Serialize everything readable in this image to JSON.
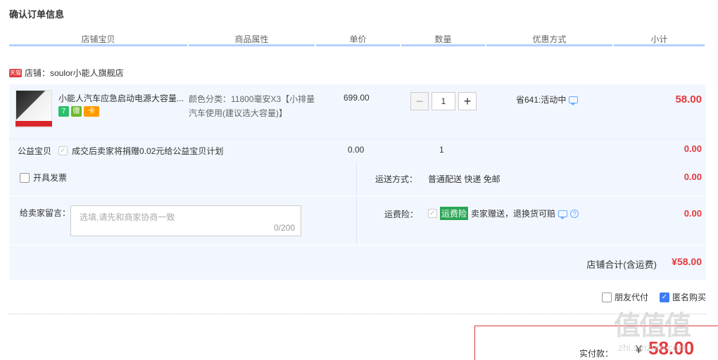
{
  "page": {
    "title": "确认订单信息"
  },
  "columns": [
    "店铺宝贝",
    "商品属性",
    "单价",
    "数量",
    "优惠方式",
    "小计"
  ],
  "shop": {
    "badge": "天猫",
    "label": "店铺：soulor小能人旗舰店"
  },
  "item": {
    "name": "小能人汽车应急启动电源大容量...",
    "tags": [
      "7",
      "赠",
      "卡"
    ],
    "attribute": "颜色分类：11800毫安X3【小排量汽车使用(建议选大容量)】",
    "price": "699.00",
    "quantity": "1",
    "promotion": "省641:活动中",
    "subtotal": "58.00"
  },
  "charity": {
    "label": "公益宝贝",
    "desc": "成交后卖家将捐赠0.02元给公益宝贝计划",
    "price": "0.00",
    "quantity": "1",
    "subtotal": "0.00"
  },
  "invoice": {
    "label": "开具发票"
  },
  "memo": {
    "label": "给卖家留言：",
    "placeholder": "选填,请先和商家协商一致",
    "counter": "0/200"
  },
  "shipping": {
    "label": "运送方式：",
    "value": "普通配送 快递 免邮",
    "price": "0.00"
  },
  "insurance": {
    "label": "运费险：",
    "badge": "运费险",
    "desc": "卖家赠送，退换货可赔",
    "price": "0.00"
  },
  "total": {
    "label": "店铺合计(含运费)",
    "value": "¥58.00"
  },
  "options": {
    "friend_pay": "朋友代付",
    "anonymous": "匿名购买"
  },
  "payment": {
    "label": "实付款：",
    "currency": "¥",
    "value": "58.00"
  },
  "watermark": {
    "main": "值值值",
    "sub": "zhi.smzdm.com"
  }
}
